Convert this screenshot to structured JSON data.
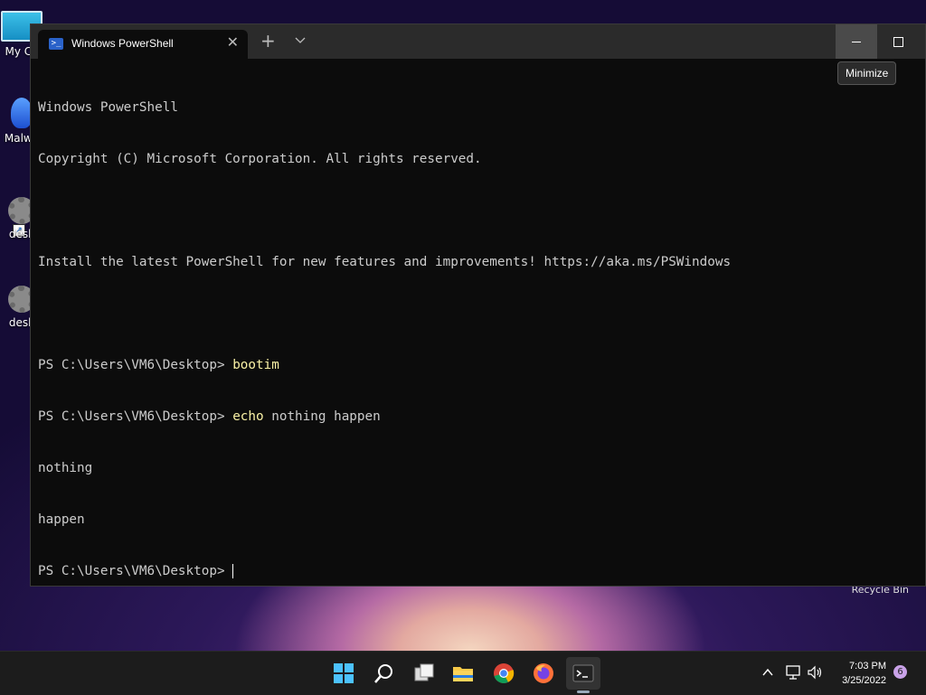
{
  "desktop": {
    "icons": [
      {
        "label": "My Co",
        "icon": "computer-icon"
      },
      {
        "label": "Malwa",
        "icon": "malware-app-icon"
      },
      {
        "label": "desk",
        "icon": "gear-icon"
      },
      {
        "label": "desk",
        "icon": "gear-icon"
      }
    ],
    "recycle_bin_label": "Recycle Bin"
  },
  "window": {
    "tab_title": "Windows PowerShell",
    "tab_icon": "powershell-icon",
    "tooltip": "Minimize"
  },
  "terminal": {
    "lines": [
      {
        "text": "Windows PowerShell"
      },
      {
        "text": "Copyright (C) Microsoft Corporation. All rights reserved."
      },
      {
        "text": ""
      },
      {
        "text": "Install the latest PowerShell for new features and improvements! https://aka.ms/PSWindows"
      },
      {
        "text": ""
      },
      {
        "prompt": "PS C:\\Users\\VM6\\Desktop> ",
        "cmd": "bootim",
        "args": ""
      },
      {
        "prompt": "PS C:\\Users\\VM6\\Desktop> ",
        "cmd": "echo",
        "args": " nothing happen"
      },
      {
        "text": "nothing"
      },
      {
        "text": "happen"
      },
      {
        "prompt": "PS C:\\Users\\VM6\\Desktop> ",
        "cmd": "",
        "args": "",
        "cursor": true
      }
    ],
    "colors": {
      "background": "#0c0c0c",
      "text": "#cccccc",
      "command": "#f9f1a5"
    }
  },
  "taskbar": {
    "apps": [
      "start-icon",
      "search-icon",
      "task-view-icon",
      "file-explorer-icon",
      "chrome-icon",
      "firefox-icon",
      "terminal-icon"
    ],
    "time": "7:03 PM",
    "date": "3/25/2022",
    "notification_count": "6"
  }
}
